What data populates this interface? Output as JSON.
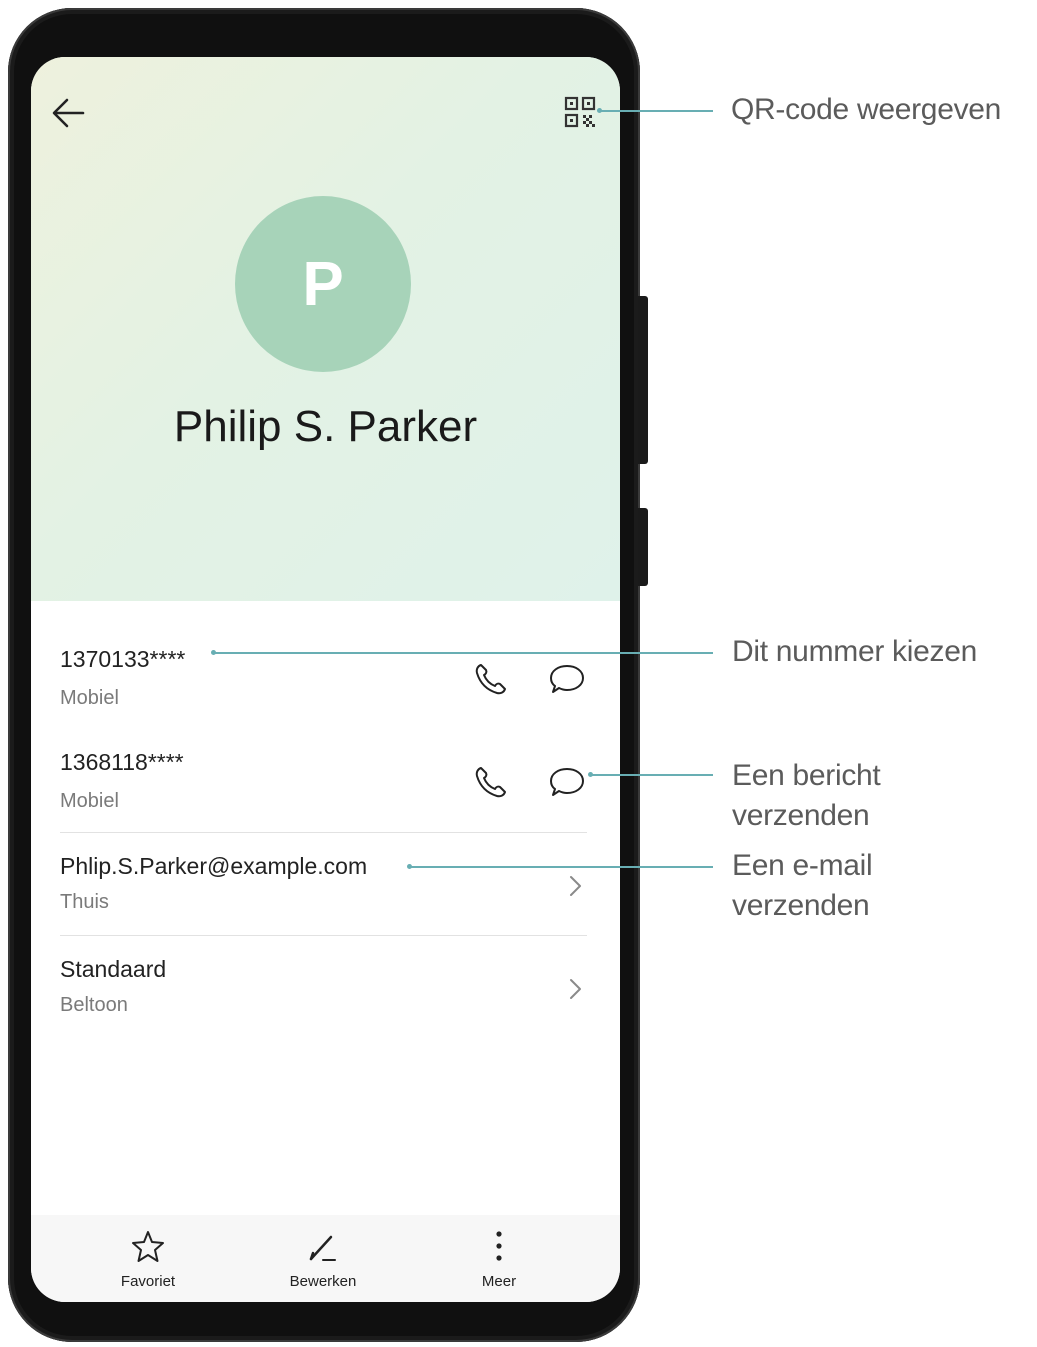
{
  "contact": {
    "avatar_initial": "P",
    "name": "Philip S. Parker"
  },
  "numbers": [
    {
      "number": "1370133****",
      "type": "Mobiel"
    },
    {
      "number": "1368118****",
      "type": "Mobiel"
    }
  ],
  "email": {
    "address": "Phlip.S.Parker@example.com",
    "type": "Thuis"
  },
  "ringtone": {
    "value": "Standaard",
    "label": "Beltoon"
  },
  "bottom_bar": {
    "favorite": "Favoriet",
    "edit": "Bewerken",
    "more": "Meer"
  },
  "callouts": {
    "qr": "QR-code weergeven",
    "dial": "Dit nummer kiezen",
    "message_line1": "Een bericht",
    "message_line2": "verzenden",
    "email_line1": "Een e-mail",
    "email_line2": "verzenden"
  },
  "colors": {
    "avatar": "#a7d3b9",
    "callout": "#68aeb3"
  },
  "icons": [
    "back-arrow-icon",
    "qr-code-icon",
    "phone-icon",
    "message-icon",
    "chevron-right-icon",
    "star-icon",
    "pencil-icon",
    "more-vertical-icon"
  ]
}
